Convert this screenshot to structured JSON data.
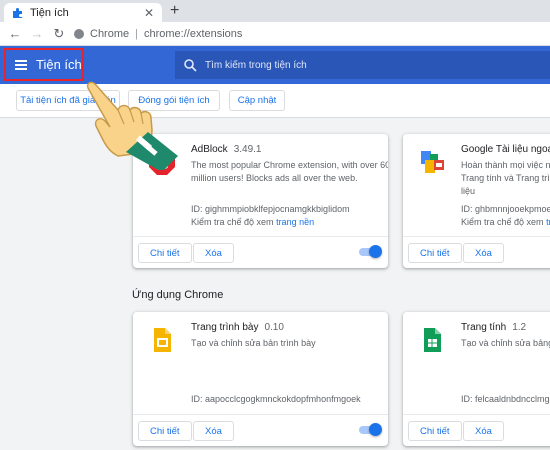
{
  "tab": {
    "title": "Tiện ích",
    "icon": "puzzle-icon"
  },
  "toolbar": {
    "scheme": "Chrome",
    "separator": "|",
    "url": "chrome://extensions"
  },
  "header": {
    "title": "Tiện ích",
    "search_placeholder": "Tìm kiếm trong tiện ích"
  },
  "actions": {
    "load_unpacked": "Tải tiện ích đã giải nén",
    "pack": "Đóng gói tiện ích",
    "update": "Cập nhật"
  },
  "extensions": [
    {
      "name": "AdBlock",
      "version": "3.49.1",
      "description": "The most popular Chrome extension, with over 60 million users! Blocks ads all over the web.",
      "id": "ID: gighmmpiobklfepjocnamgkkbiglidom",
      "inspect": "Kiểm tra chế độ xem",
      "inspect_link": "trang nền",
      "details": "Chi tiết",
      "remove": "Xóa",
      "enabled": true
    },
    {
      "name": "Google Tài liệu ngoại tuyến",
      "version": "",
      "description": "Hoàn thành mọi việc ngoại tuyến với Google Tài liệu, Trang tính và Trang trình bày – phẩm của Google Tài liệu",
      "id": "ID: ghbmnnjooekpmoecnnnilnnbdlolhkhi",
      "inspect": "Kiểm tra chế độ xem",
      "inspect_link": "tr",
      "details": "Chi tiết",
      "remove": "Xóa",
      "enabled": true
    }
  ],
  "apps_section": "Ứng dụng Chrome",
  "apps": [
    {
      "name": "Trang trình bày",
      "version": "0.10",
      "description": "Tạo và chỉnh sửa bản trình bày",
      "id": "ID: aapocclcgogkmnckokdopfmhonfmgoek",
      "details": "Chi tiết",
      "remove": "Xóa",
      "enabled": true
    },
    {
      "name": "Trang tính",
      "version": "1.2",
      "description": "Tạo và chỉnh sửa bảng tính",
      "id": "ID: felcaaldnbdncclmgdcncolpebgiejap",
      "details": "Chi tiết",
      "remove": "Xóa",
      "enabled": true
    }
  ],
  "colors": {
    "header": "#3367d6",
    "accent": "#1a73e8",
    "highlight_box": "#e8232b",
    "hand_sleeve": "#1e8a6b"
  }
}
